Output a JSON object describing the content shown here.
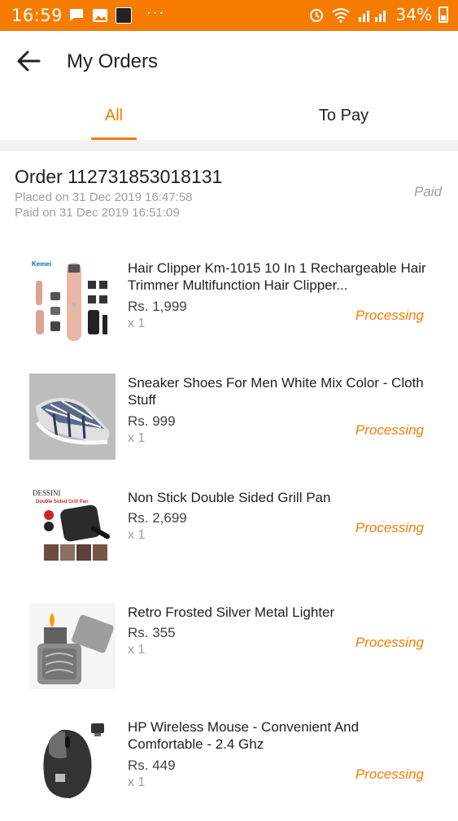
{
  "status_bar": {
    "time": "16:59",
    "dots": "···",
    "battery": "34%"
  },
  "header": {
    "title": "My Orders"
  },
  "tabs": [
    {
      "label": "All",
      "active": true
    },
    {
      "label": "To Pay",
      "active": false
    }
  ],
  "order": {
    "number": "Order 112731853018131",
    "placed": "Placed on 31 Dec 2019  16:47:58",
    "paid": "Paid on 31 Dec 2019  16:51:09",
    "status": "Paid",
    "items": [
      {
        "title": "Hair Clipper Km-1015 10 In 1 Rechargeable Hair Trimmer Multifunction Hair Clipper...",
        "price": "Rs. 1,999",
        "qty": "x 1",
        "status": "Processing",
        "image_brand": "Kemei"
      },
      {
        "title": "Sneaker Shoes For Men White Mix Color - Cloth Stuff",
        "price": "Rs. 999",
        "qty": "x 1",
        "status": "Processing"
      },
      {
        "title": "Non Stick Double Sided Grill Pan",
        "price": "Rs. 2,699",
        "qty": "x 1",
        "status": "Processing",
        "image_brand": "DESSINI",
        "image_caption": "Double Sided Grill Pan"
      },
      {
        "title": "Retro Frosted Silver Metal Lighter",
        "price": "Rs. 355",
        "qty": "x 1",
        "status": "Processing"
      },
      {
        "title": "HP Wireless Mouse - Convenient And Comfortable - 2.4 Ghz",
        "price": "Rs. 449",
        "qty": "x 1",
        "status": "Processing"
      }
    ]
  },
  "colors": {
    "accent": "#f57c00",
    "muted": "#9e9e9e",
    "separator": "#f2f2f2"
  }
}
